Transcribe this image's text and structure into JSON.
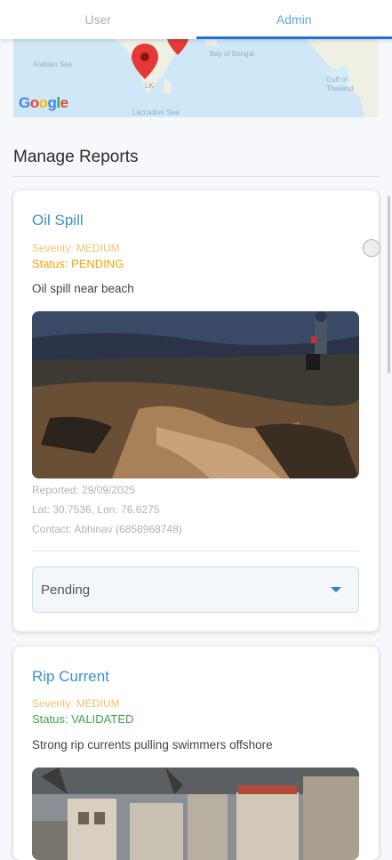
{
  "tabs": [
    {
      "label": "User",
      "active": false
    },
    {
      "label": "Admin",
      "active": true
    }
  ],
  "map": {
    "labels": {
      "arabian_sea": "Arabian Sea",
      "bay_of_bengal": "Bay of Bengal",
      "gulf_of_thailand": "Gulf of Thailand",
      "laccadive_sea": "Laccadive Sea",
      "country_code": "LK"
    },
    "attribution": [
      "G",
      "o",
      "o",
      "g",
      "l",
      "e"
    ]
  },
  "section_title": "Manage Reports",
  "reports": [
    {
      "title": "Oil Spill",
      "severity": "Severity: MEDIUM",
      "status": "Status: PENDING",
      "status_color": "#f0a500",
      "description": "Oil spill near beach",
      "reported": "Reported: 29/09/2025",
      "location": "Lat: 30.7536, Lon: 76.6275",
      "contact": "Contact: Abhinav  (6858968748)",
      "status_select": "Pending"
    },
    {
      "title": "Rip Current",
      "severity": "Severity: MEDIUM",
      "status": "Status: VALIDATED",
      "status_color": "#3aa64a",
      "description": "Strong rip currents pulling swimmers offshore"
    }
  ],
  "colors": {
    "accent": "#1e6fe0",
    "title_blue": "#3d8fd6",
    "severity": "#f2c36b"
  }
}
